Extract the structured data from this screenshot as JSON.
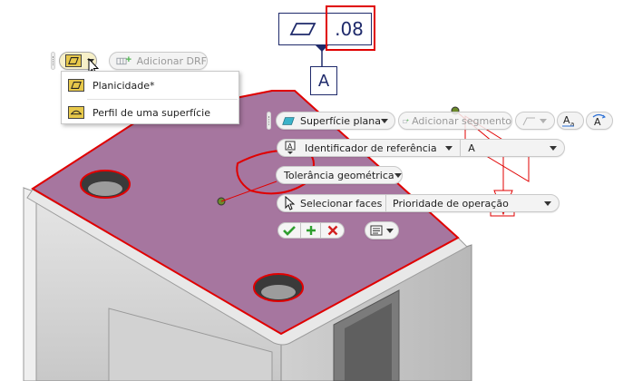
{
  "colors": {
    "face_fill": "#a6769f",
    "highlight_red": "#e00000",
    "annotation_blue": "#1f2a6b",
    "ok_green": "#2f9e2f",
    "cancel_red": "#d32020",
    "part_gray": "#d8d8d8"
  },
  "fcf": {
    "symbol_icon": "flatness-icon",
    "tolerance": ".08",
    "datum": "A"
  },
  "mini_toolbar_top": {
    "symbol_icon": "flatness-icon",
    "add_drf_icon": "add-drf-icon",
    "add_drf_label": "Adicionar DRF"
  },
  "symbol_menu": {
    "items": [
      {
        "icon": "flatness-icon",
        "label": "Planicidade*"
      },
      {
        "icon": "surface-profile-icon",
        "label": "Perfil de uma superfície"
      }
    ]
  },
  "mini_toolbar_main": {
    "surface_type_icon": "flat-surface-icon",
    "surface_type": "Superfície plana",
    "add_segment_label": "Adicionar segmento",
    "datum_id_label": "Identificador de referência",
    "datum_id_value": "A",
    "tolerance_label": "Tolerância geométrica",
    "select_faces_label": "Selecionar faces",
    "priority_label": "Prioridade de operação",
    "text_style_icon": "text-style-icon",
    "text_edit_icon": "text-edit-icon",
    "ok_icon": "checkmark-icon",
    "apply_icon": "plus-icon",
    "cancel_icon": "close-icon",
    "options_icon": "list-options-icon"
  }
}
